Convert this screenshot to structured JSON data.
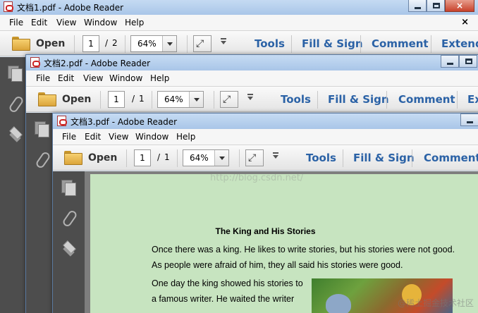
{
  "windows": [
    {
      "id": "w1",
      "title": "文档1.pdf - Adobe Reader",
      "page_current": "1",
      "page_total": "2",
      "zoom": "64%"
    },
    {
      "id": "w2",
      "title": "文档2.pdf - Adobe Reader",
      "page_current": "1",
      "page_total": "1",
      "zoom": "64%"
    },
    {
      "id": "w3",
      "title": "文档3.pdf - Adobe Reader",
      "page_current": "1",
      "page_total": "1",
      "zoom": "64%"
    }
  ],
  "menu": {
    "file": "File",
    "edit": "Edit",
    "view": "View",
    "window": "Window",
    "help": "Help",
    "close": "×"
  },
  "toolbar": {
    "open": "Open",
    "slash": "/",
    "tools": "Tools",
    "fill_sign": "Fill & Sign",
    "comment": "Comment",
    "extend_w1": "Extend",
    "extend_w2": "Ex"
  },
  "window_controls": {
    "close_glyph": "×"
  },
  "document": {
    "heading": "The King and His Stories",
    "lines": [
      "Once there was a king. He likes to write stories, but his stories were not good.",
      "As people were afraid of him, they all said his stories were good.",
      "One day the king showed his stories to",
      "a famous writer. He waited the writer"
    ]
  },
  "watermarks": {
    "center": "http://blog.csdn.net/",
    "corner": "@稀土掘金技术社区"
  },
  "colors": {
    "link_blue": "#2b62a6",
    "page_green": "#c7e4c0",
    "nav_gray": "#4d4d4d"
  }
}
